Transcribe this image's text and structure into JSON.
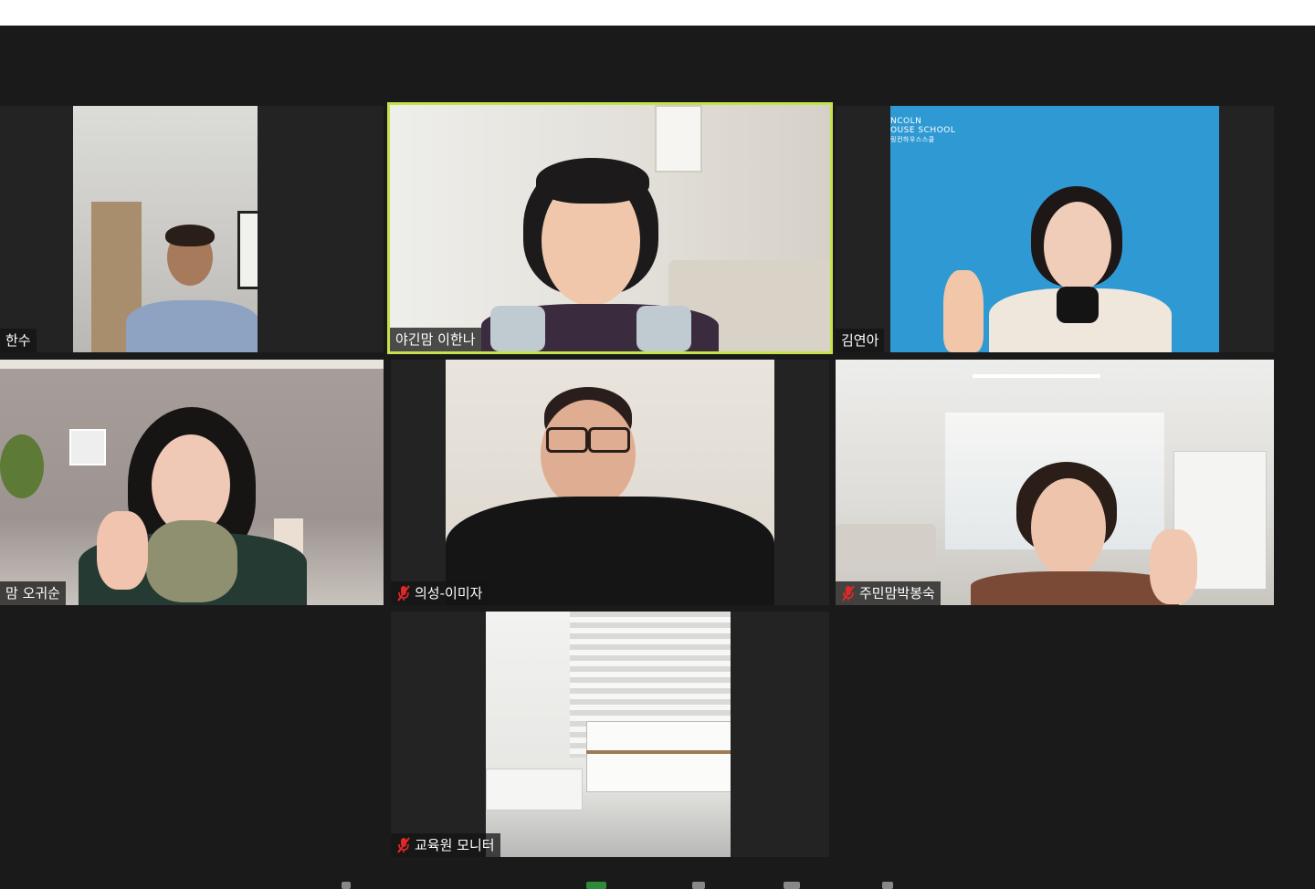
{
  "participants": [
    {
      "name": "한수",
      "muted": false
    },
    {
      "name": "야긴맘 이한나",
      "muted": false
    },
    {
      "name": "김연아",
      "muted": false
    },
    {
      "name": "맘 오귀순",
      "muted": false
    },
    {
      "name": "의성-이미자",
      "muted": true
    },
    {
      "name": "주민맘박봉숙",
      "muted": true
    },
    {
      "name": "교육원 모니터",
      "muted": true
    }
  ],
  "backdrop_text": {
    "line1": "NCOLN",
    "line2": "OUSE SCHOOL",
    "line3": "링컨하우스스쿨"
  },
  "colors": {
    "active_speaker": "#c5e34a",
    "muted_icon": "#e02828",
    "background": "#1a1a1a"
  },
  "icons": [
    "mic-muted-icon"
  ]
}
